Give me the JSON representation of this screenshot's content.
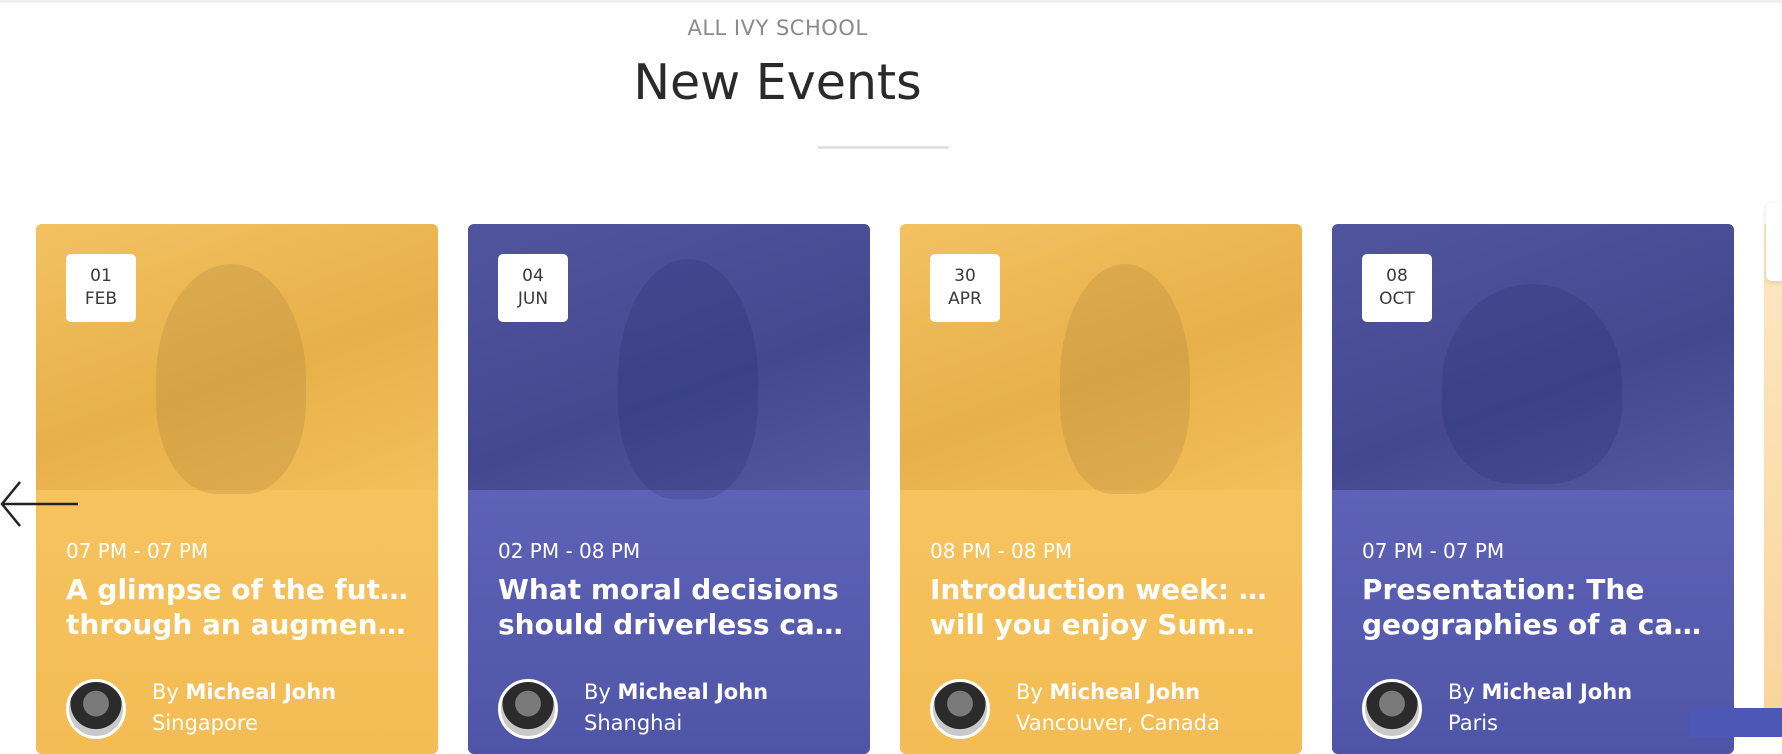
{
  "header": {
    "kicker": "ALL IVY SCHOOL",
    "title": "New Events"
  },
  "events": [
    {
      "day": "01",
      "month": "FEB",
      "time": "07 PM - 07 PM",
      "title_line1": "A glimpse of the future",
      "title_line2": "through an augmented...",
      "by_prefix": "By",
      "author": "Micheal John",
      "location": "Singapore",
      "theme": "yellow"
    },
    {
      "day": "04",
      "month": "JUN",
      "time": "02 PM - 08 PM",
      "title_line1": "What moral decisions",
      "title_line2": "should driverless cars...",
      "by_prefix": "By",
      "author": "Micheal John",
      "location": "Shanghai",
      "theme": "blue"
    },
    {
      "day": "30",
      "month": "APR",
      "time": "08 PM - 08 PM",
      "title_line1": "Introduction week: How",
      "title_line2": "will you enjoy Summer...",
      "by_prefix": "By",
      "author": "Micheal John",
      "location": "Vancouver, Canada",
      "theme": "yellow"
    },
    {
      "day": "08",
      "month": "OCT",
      "time": "07 PM - 07 PM",
      "title_line1": "Presentation: The",
      "title_line2": "geographies of a care...",
      "by_prefix": "By",
      "author": "Micheal John",
      "location": "Paris",
      "theme": "blue"
    }
  ],
  "icons": {
    "prev": "arrow-left-icon"
  },
  "colors": {
    "yellow": "#F5C15A",
    "blue": "#5A5FB4",
    "accent": "#4C57B6"
  }
}
